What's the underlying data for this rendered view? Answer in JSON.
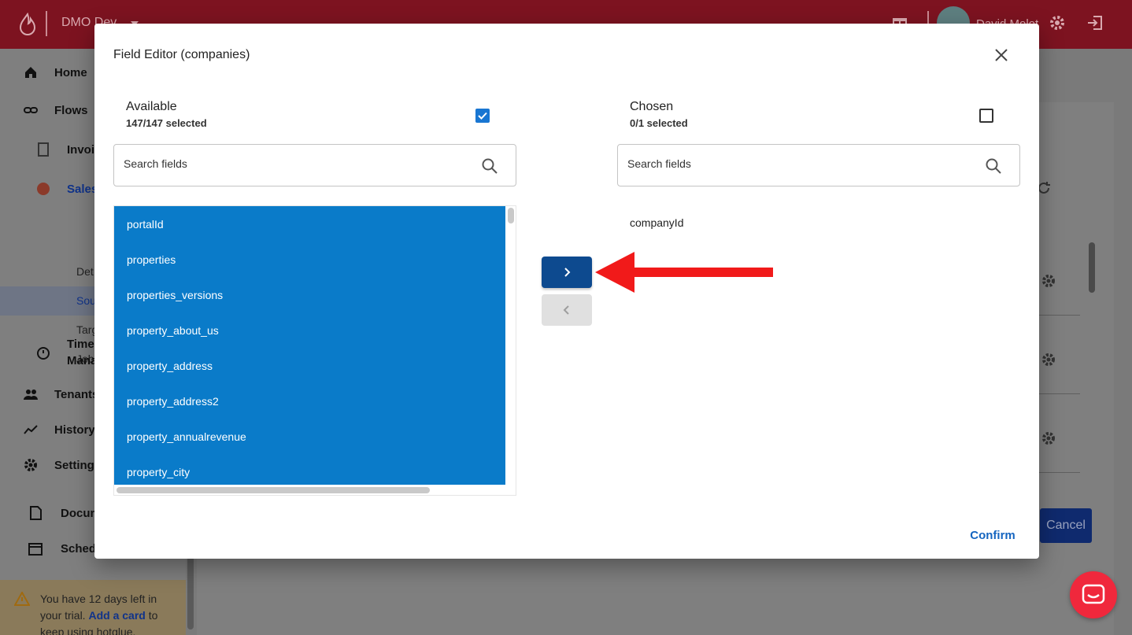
{
  "topbar": {
    "workspace": "DMO Dev",
    "user_name": "David Molot"
  },
  "sidebar": {
    "items": [
      {
        "label": "Home"
      },
      {
        "label": "Flows"
      },
      {
        "label": "Invoic"
      },
      {
        "label": "Sales"
      },
      {
        "label": "Time Mana"
      },
      {
        "label": "Tenants"
      },
      {
        "label": "History"
      },
      {
        "label": "Settings"
      },
      {
        "label": "Docum"
      },
      {
        "label": "Schedu"
      }
    ],
    "subitems": [
      "Det",
      "Sou",
      "Targ",
      "Jobs"
    ]
  },
  "trial": {
    "text_before": "You have 12 days left in your trial.",
    "link": "Add a card",
    "text_after": "to keep using hotglue."
  },
  "background": {
    "cancel_label": "Cancel"
  },
  "dialog": {
    "title": "Field Editor (companies)",
    "available": {
      "title": "Available",
      "count": "147/147 selected",
      "all_checked": true,
      "search_placeholder": "Search fields",
      "items": [
        "portalId",
        "properties",
        "properties_versions",
        "property_about_us",
        "property_address",
        "property_address2",
        "property_annualrevenue",
        "property_city"
      ]
    },
    "chosen": {
      "title": "Chosen",
      "count": "0/1 selected",
      "all_checked": false,
      "search_placeholder": "Search fields",
      "items": [
        "companyId"
      ]
    },
    "confirm_label": "Confirm"
  }
}
